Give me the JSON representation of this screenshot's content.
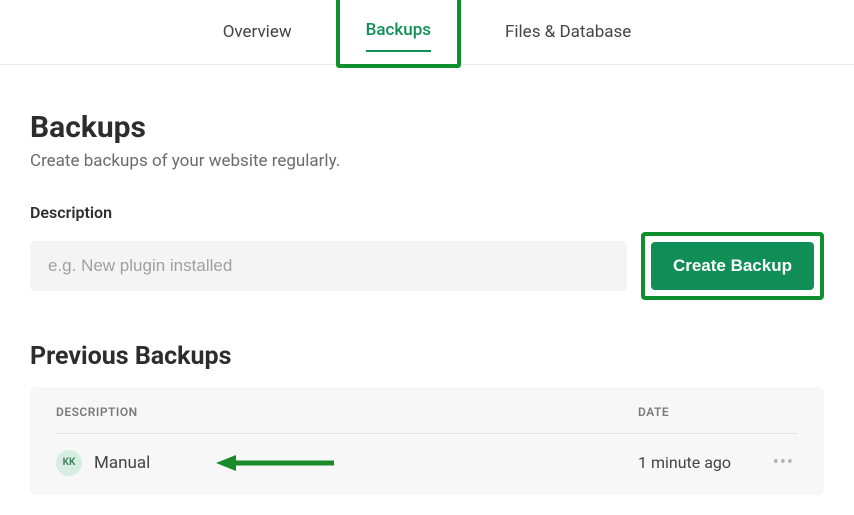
{
  "tabs": [
    {
      "label": "Overview"
    },
    {
      "label": "Backups"
    },
    {
      "label": "Files & Database"
    }
  ],
  "page": {
    "title": "Backups",
    "subtitle": "Create backups of your website regularly."
  },
  "form": {
    "label": "Description",
    "placeholder": "e.g. New plugin installed",
    "button": "Create Backup"
  },
  "previous": {
    "title": "Previous Backups",
    "headers": {
      "desc": "DESCRIPTION",
      "date": "DATE"
    },
    "rows": [
      {
        "avatar": "KK",
        "desc": "Manual",
        "date": "1 minute ago"
      }
    ]
  }
}
